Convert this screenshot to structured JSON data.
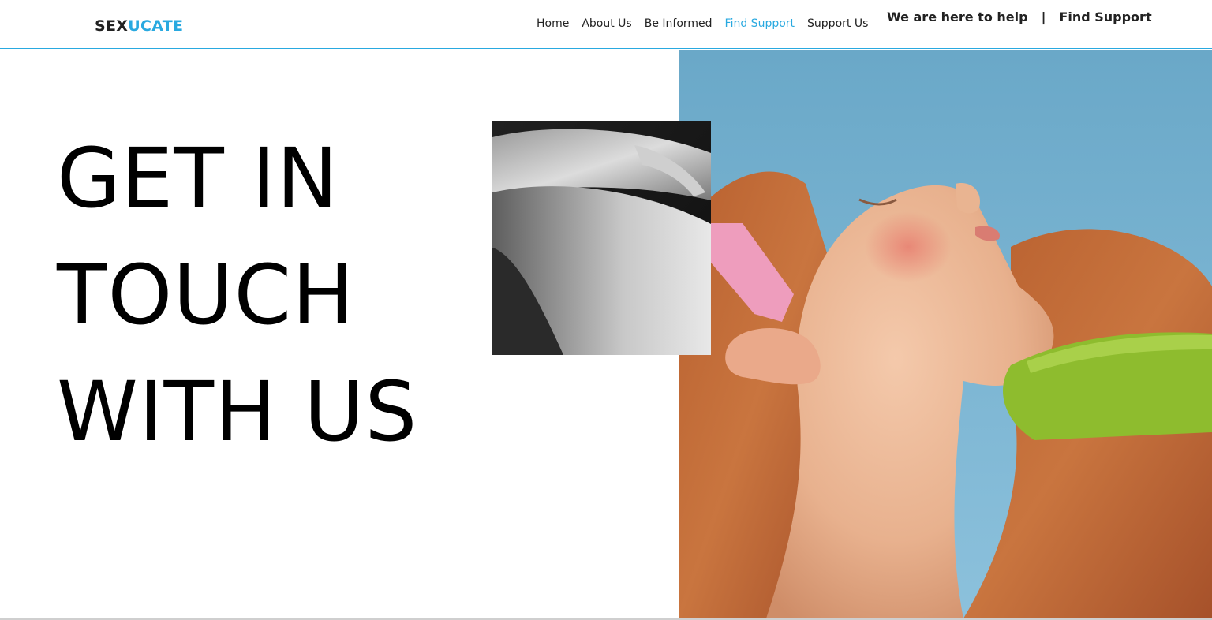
{
  "brand": {
    "part1": "SEX",
    "part2": "UCATE"
  },
  "nav": {
    "items": [
      {
        "label": "Home"
      },
      {
        "label": "About Us"
      },
      {
        "label": "Be Informed"
      },
      {
        "label": "Find Support"
      },
      {
        "label": "Support Us"
      }
    ],
    "active_index": 3
  },
  "cta": {
    "tagline": "We are here to help",
    "separator": "|",
    "link": "Find Support"
  },
  "hero": {
    "line1": "GET IN",
    "line2": "TOUCH",
    "line3": "WITH US"
  },
  "colors": {
    "accent": "#29a9e0",
    "text": "#111111",
    "sky": "#6aaccc",
    "hair": "#c1683a"
  }
}
